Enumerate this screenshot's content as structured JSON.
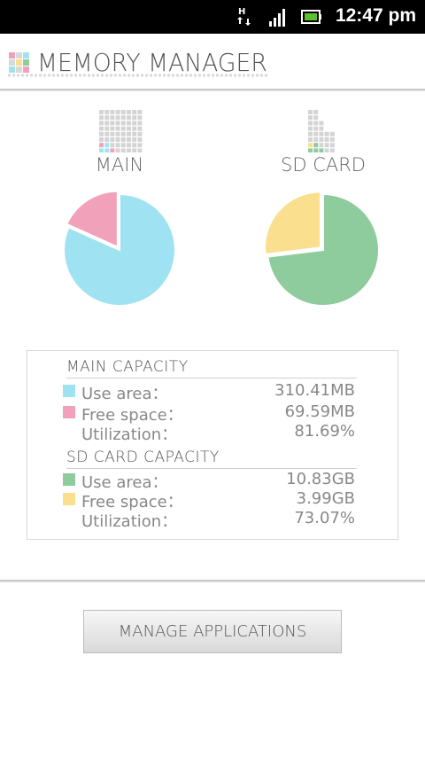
{
  "status_bar": {
    "time": "12:47 pm",
    "network_icon": "h-plus-data-icon",
    "signal_icon": "signal-strength-icon",
    "battery_icon": "battery-icon"
  },
  "header": {
    "title": "MEMORY MANAGER"
  },
  "colors": {
    "use_main": "#9fe3f3",
    "free_main": "#f2a1ba",
    "use_sd": "#8ecb9d",
    "free_sd": "#fadf8e",
    "grid": "#d4d4d4"
  },
  "charts": {
    "main": {
      "label": "MAIN"
    },
    "sd": {
      "label": "SD CARD"
    }
  },
  "chart_data": [
    {
      "type": "pie",
      "categories": [
        "Use area",
        "Free space"
      ],
      "values": [
        81.69,
        18.31
      ]
    },
    {
      "type": "pie",
      "categories": [
        "Use area",
        "Free space"
      ],
      "values": [
        73.07,
        26.93
      ]
    }
  ],
  "capacity": {
    "main": {
      "title": "MAIN CAPACITY",
      "use_label": "Use area：",
      "use_value": "310.41MB",
      "free_label": "Free space：",
      "free_value": "69.59MB",
      "util_label": "Utilization：",
      "util_value": "81.69%"
    },
    "sd": {
      "title": "SD CARD CAPACITY",
      "use_label": "Use area：",
      "use_value": "10.83GB",
      "free_label": "Free space：",
      "free_value": "3.99GB",
      "util_label": "Utilization：",
      "util_value": "73.07%"
    }
  },
  "actions": {
    "manage_label": "MANAGE APPLICATIONS"
  }
}
